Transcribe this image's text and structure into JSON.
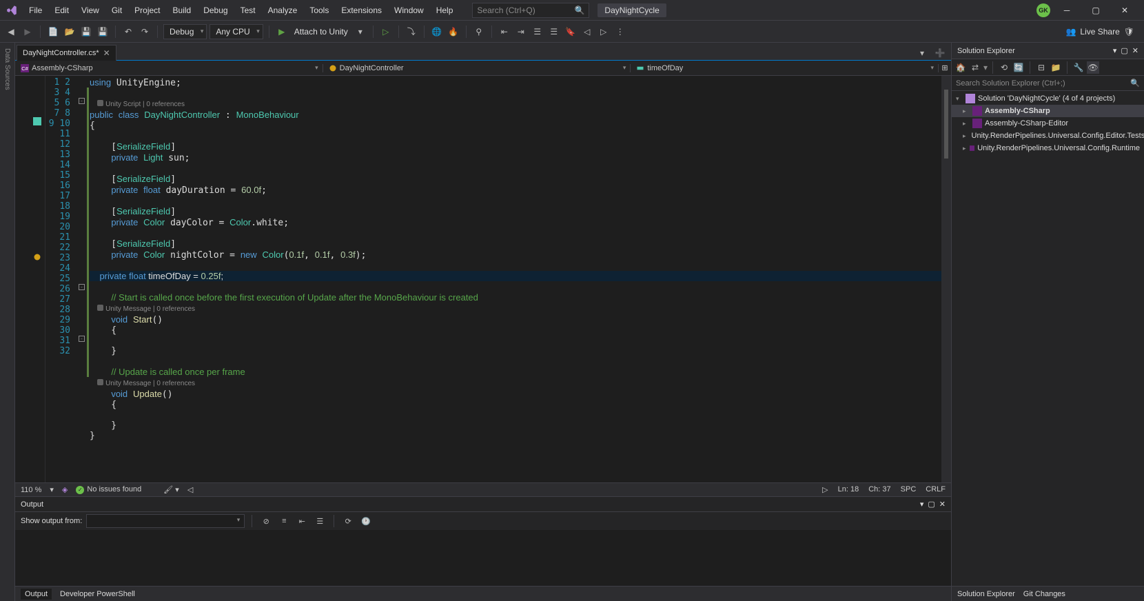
{
  "menu": [
    "File",
    "Edit",
    "View",
    "Git",
    "Project",
    "Build",
    "Debug",
    "Test",
    "Analyze",
    "Tools",
    "Extensions",
    "Window",
    "Help"
  ],
  "search_placeholder": "Search (Ctrl+Q)",
  "project_name": "DayNightCycle",
  "avatar_initials": "GK",
  "toolbar": {
    "config": "Debug",
    "platform": "Any CPU",
    "attach": "Attach to Unity"
  },
  "liveshare": "Live Share",
  "vbars": [
    "Data Sources"
  ],
  "tab": {
    "name": "DayNightController.cs*"
  },
  "nav": {
    "project": "Assembly-CSharp",
    "class": "DayNightController",
    "member": "timeOfDay"
  },
  "code_hints": {
    "unity_script": "Unity Script | 0 references",
    "unity_msg": "Unity Message | 0 references"
  },
  "solution": {
    "title": "Solution Explorer",
    "search_placeholder": "Search Solution Explorer (Ctrl+;)",
    "root": "Solution 'DayNightCycle' (4 of 4 projects)",
    "projects": [
      "Assembly-CSharp",
      "Assembly-CSharp-Editor",
      "Unity.RenderPipelines.Universal.Config.Editor.Tests",
      "Unity.RenderPipelines.Universal.Config.Runtime"
    ]
  },
  "status": {
    "zoom": "110 %",
    "issues": "No issues found",
    "ln": "Ln: 18",
    "ch": "Ch: 37",
    "spc": "SPC",
    "enc": "CRLF"
  },
  "output": {
    "title": "Output",
    "label": "Show output from:"
  },
  "bottom_tabs": [
    "Output",
    "Developer PowerShell"
  ],
  "right_footer": [
    "Solution Explorer",
    "Git Changes"
  ]
}
